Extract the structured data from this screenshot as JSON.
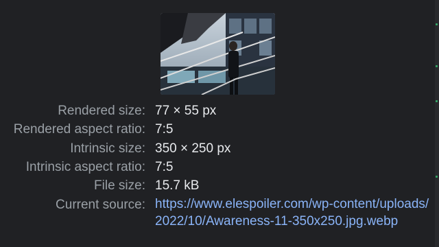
{
  "image_info": {
    "rows": [
      {
        "label": "Rendered size:",
        "value": "77 × 55 px"
      },
      {
        "label": "Rendered aspect ratio:",
        "value": "7:5"
      },
      {
        "label": "Intrinsic size:",
        "value": "350 × 250 px"
      },
      {
        "label": "Intrinsic aspect ratio:",
        "value": "7:5"
      },
      {
        "label": "File size:",
        "value": "15.7 kB"
      }
    ],
    "source_label": "Current source:",
    "source_url": "https://www.elespoiler.com/wp-content/uploads/2022/10/Awareness-11-350x250.jpg.webp"
  },
  "colors": {
    "background": "#202124",
    "label": "#9aa0a6",
    "value": "#e8eaed",
    "link": "#8ab4f8"
  }
}
